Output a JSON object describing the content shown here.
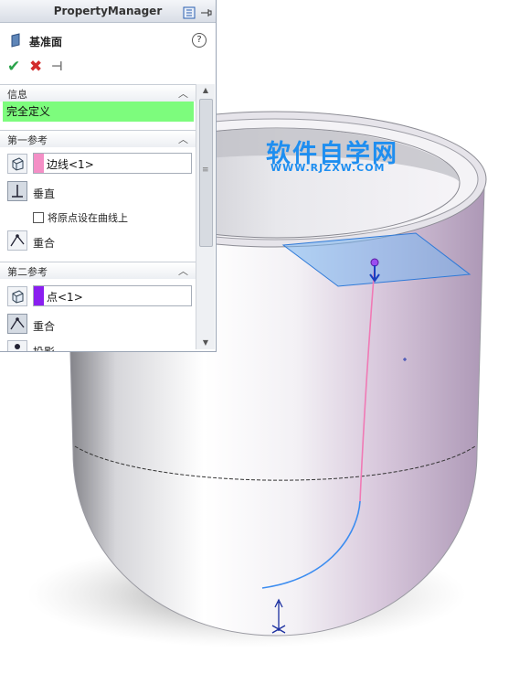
{
  "panel": {
    "title": "PropertyManager",
    "feature_name": "基准面",
    "help_label": "?",
    "actions": {
      "ok": "✔",
      "cancel": "✖",
      "pin": "⊣"
    }
  },
  "info_section": {
    "title": "信息",
    "status": "完全定义"
  },
  "first_reference": {
    "title": "第一参考",
    "value": "边线<1>",
    "swatch_color": "#f48fc6",
    "options": [
      "垂直",
      "重合"
    ],
    "checkbox_label": "将原点设在曲线上"
  },
  "second_reference": {
    "title": "第二参考",
    "value": "点<1>",
    "swatch_color": "#8a1ef0",
    "options": [
      "重合",
      "投影"
    ]
  },
  "watermark": {
    "main": "软件自学网",
    "sub": "WWW.RJZXW.COM"
  },
  "colors": {
    "status_green": "#7dfc7d",
    "path_pink": "#f07ab5",
    "path_blue": "#3b8cf0",
    "plane_blue": "#78b4f0",
    "pot_gray": "#dcdde2"
  }
}
